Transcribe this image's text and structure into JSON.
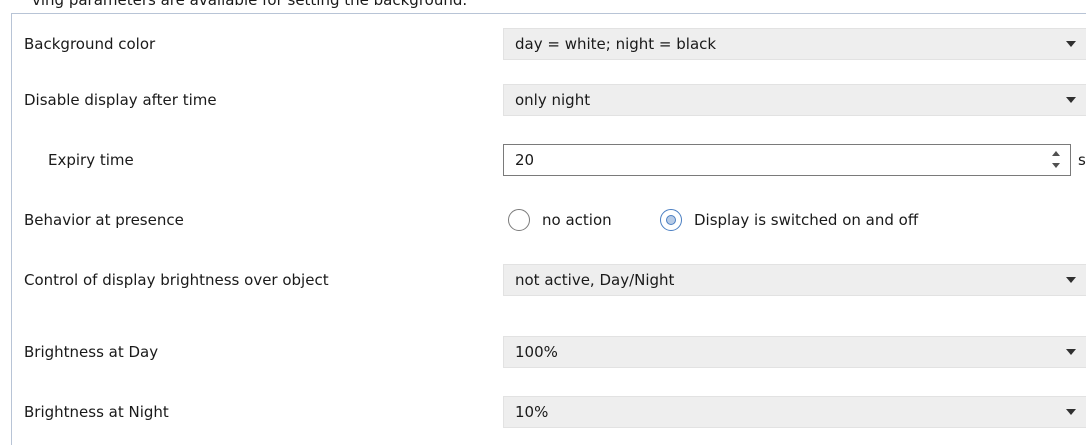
{
  "header_fragment": "ving parameters are available for setting the background.",
  "rows": [
    {
      "label": "Background color",
      "value": "day = white; night = black"
    },
    {
      "label": "Disable display after time",
      "value": "only night"
    },
    {
      "label": "Expiry time",
      "value": "20",
      "unit": "s"
    },
    {
      "label": "Behavior at presence",
      "options": [
        "no action",
        "Display is switched on and off"
      ],
      "selected": "Display is switched on and off"
    },
    {
      "label": "Control of display brightness over object",
      "value": "not active, Day/Night"
    },
    {
      "label": "Brightness at Day",
      "value": "100%"
    },
    {
      "label": "Brightness at Night",
      "value": "10%"
    }
  ],
  "icons": {
    "dropdown": "chevron-down-icon",
    "spinner_up": "spinner-up-icon",
    "spinner_down": "spinner-down-icon"
  },
  "colors": {
    "panel_border": "#b8c4d6",
    "field_background": "#eeeeee",
    "radio_checked": "#4a7ec2"
  }
}
